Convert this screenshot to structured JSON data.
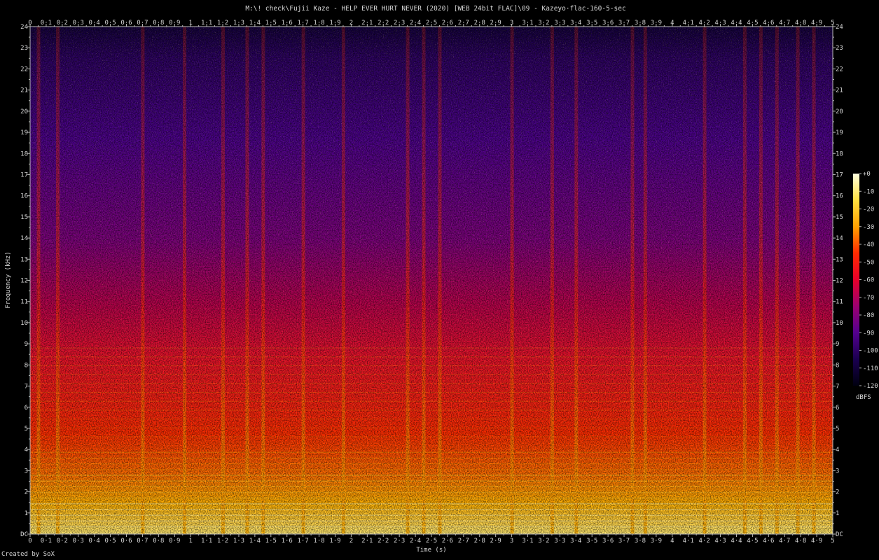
{
  "chart_data": {
    "type": "heatmap",
    "title": "M:\\! check\\Fujii Kaze - HELP EVER HURT NEVER (2020) [WEB 24bit FLAC]\\09 - Kazeyo·flac-160-5-sec",
    "xlabel": "Time (s)",
    "ylabel": "Frequency (kHz)",
    "xlim": [
      0,
      5
    ],
    "ylim": [
      0,
      24
    ],
    "x_ticks": [
      "0",
      "0·1",
      "0·2",
      "0·3",
      "0·4",
      "0·5",
      "0·6",
      "0·7",
      "0·8",
      "0·9",
      "1",
      "1·1",
      "1·2",
      "1·3",
      "1·4",
      "1·5",
      "1·6",
      "1·7",
      "1·8",
      "1·9",
      "2",
      "2·1",
      "2·2",
      "2·3",
      "2·4",
      "2·5",
      "2·6",
      "2·7",
      "2·8",
      "2·9",
      "3",
      "3·1",
      "3·2",
      "3·3",
      "3·4",
      "3·5",
      "3·6",
      "3·7",
      "3·8",
      "3·9",
      "4",
      "4·1",
      "4·2",
      "4·3",
      "4·4",
      "4·5",
      "4·6",
      "4·7",
      "4·8",
      "4·9",
      "5"
    ],
    "y_ticks": [
      "DC",
      "1",
      "2",
      "3",
      "4",
      "5",
      "6",
      "7",
      "8",
      "9",
      "10",
      "11",
      "12",
      "13",
      "14",
      "15",
      "16",
      "17",
      "18",
      "19",
      "20",
      "21",
      "22",
      "23",
      "24"
    ],
    "colorbar": {
      "label": "dBFS",
      "range": [
        -120,
        0
      ],
      "ticks": [
        "+0",
        "-10",
        "-20",
        "-30",
        "-40",
        "-50",
        "-60",
        "-70",
        "-80",
        "-90",
        "-100",
        "-110",
        "-120"
      ]
    },
    "colormap": [
      "#ffffe0",
      "#ffe040",
      "#ffa000",
      "#ff2a00",
      "#e8002a",
      "#9b0070",
      "#54008f",
      "#1a0050",
      "#000010"
    ],
    "bright_band_below_khz": 4,
    "onset_times": [
      0.05,
      0.17,
      0.7,
      0.96,
      1.2,
      1.35,
      1.45,
      1.7,
      1.95,
      2.35,
      2.45,
      2.55,
      3.0,
      3.25,
      3.4,
      3.75,
      3.83,
      4.2,
      4.45,
      4.55,
      4.65,
      4.78,
      4.88
    ]
  },
  "credit": "Created by SoX"
}
